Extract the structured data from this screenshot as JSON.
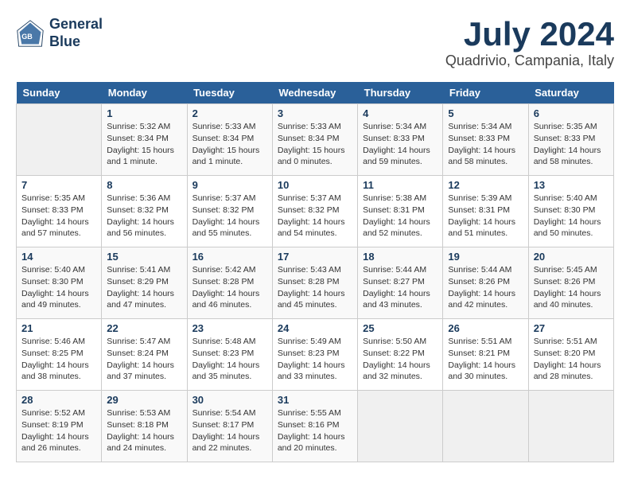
{
  "logo": {
    "line1": "General",
    "line2": "Blue"
  },
  "title": "July 2024",
  "location": "Quadrivio, Campania, Italy",
  "days_of_week": [
    "Sunday",
    "Monday",
    "Tuesday",
    "Wednesday",
    "Thursday",
    "Friday",
    "Saturday"
  ],
  "weeks": [
    [
      {
        "day": "",
        "sunrise": "",
        "sunset": "",
        "daylight": ""
      },
      {
        "day": "1",
        "sunrise": "Sunrise: 5:32 AM",
        "sunset": "Sunset: 8:34 PM",
        "daylight": "Daylight: 15 hours and 1 minute."
      },
      {
        "day": "2",
        "sunrise": "Sunrise: 5:33 AM",
        "sunset": "Sunset: 8:34 PM",
        "daylight": "Daylight: 15 hours and 1 minute."
      },
      {
        "day": "3",
        "sunrise": "Sunrise: 5:33 AM",
        "sunset": "Sunset: 8:34 PM",
        "daylight": "Daylight: 15 hours and 0 minutes."
      },
      {
        "day": "4",
        "sunrise": "Sunrise: 5:34 AM",
        "sunset": "Sunset: 8:33 PM",
        "daylight": "Daylight: 14 hours and 59 minutes."
      },
      {
        "day": "5",
        "sunrise": "Sunrise: 5:34 AM",
        "sunset": "Sunset: 8:33 PM",
        "daylight": "Daylight: 14 hours and 58 minutes."
      },
      {
        "day": "6",
        "sunrise": "Sunrise: 5:35 AM",
        "sunset": "Sunset: 8:33 PM",
        "daylight": "Daylight: 14 hours and 58 minutes."
      }
    ],
    [
      {
        "day": "7",
        "sunrise": "Sunrise: 5:35 AM",
        "sunset": "Sunset: 8:33 PM",
        "daylight": "Daylight: 14 hours and 57 minutes."
      },
      {
        "day": "8",
        "sunrise": "Sunrise: 5:36 AM",
        "sunset": "Sunset: 8:32 PM",
        "daylight": "Daylight: 14 hours and 56 minutes."
      },
      {
        "day": "9",
        "sunrise": "Sunrise: 5:37 AM",
        "sunset": "Sunset: 8:32 PM",
        "daylight": "Daylight: 14 hours and 55 minutes."
      },
      {
        "day": "10",
        "sunrise": "Sunrise: 5:37 AM",
        "sunset": "Sunset: 8:32 PM",
        "daylight": "Daylight: 14 hours and 54 minutes."
      },
      {
        "day": "11",
        "sunrise": "Sunrise: 5:38 AM",
        "sunset": "Sunset: 8:31 PM",
        "daylight": "Daylight: 14 hours and 52 minutes."
      },
      {
        "day": "12",
        "sunrise": "Sunrise: 5:39 AM",
        "sunset": "Sunset: 8:31 PM",
        "daylight": "Daylight: 14 hours and 51 minutes."
      },
      {
        "day": "13",
        "sunrise": "Sunrise: 5:40 AM",
        "sunset": "Sunset: 8:30 PM",
        "daylight": "Daylight: 14 hours and 50 minutes."
      }
    ],
    [
      {
        "day": "14",
        "sunrise": "Sunrise: 5:40 AM",
        "sunset": "Sunset: 8:30 PM",
        "daylight": "Daylight: 14 hours and 49 minutes."
      },
      {
        "day": "15",
        "sunrise": "Sunrise: 5:41 AM",
        "sunset": "Sunset: 8:29 PM",
        "daylight": "Daylight: 14 hours and 47 minutes."
      },
      {
        "day": "16",
        "sunrise": "Sunrise: 5:42 AM",
        "sunset": "Sunset: 8:28 PM",
        "daylight": "Daylight: 14 hours and 46 minutes."
      },
      {
        "day": "17",
        "sunrise": "Sunrise: 5:43 AM",
        "sunset": "Sunset: 8:28 PM",
        "daylight": "Daylight: 14 hours and 45 minutes."
      },
      {
        "day": "18",
        "sunrise": "Sunrise: 5:44 AM",
        "sunset": "Sunset: 8:27 PM",
        "daylight": "Daylight: 14 hours and 43 minutes."
      },
      {
        "day": "19",
        "sunrise": "Sunrise: 5:44 AM",
        "sunset": "Sunset: 8:26 PM",
        "daylight": "Daylight: 14 hours and 42 minutes."
      },
      {
        "day": "20",
        "sunrise": "Sunrise: 5:45 AM",
        "sunset": "Sunset: 8:26 PM",
        "daylight": "Daylight: 14 hours and 40 minutes."
      }
    ],
    [
      {
        "day": "21",
        "sunrise": "Sunrise: 5:46 AM",
        "sunset": "Sunset: 8:25 PM",
        "daylight": "Daylight: 14 hours and 38 minutes."
      },
      {
        "day": "22",
        "sunrise": "Sunrise: 5:47 AM",
        "sunset": "Sunset: 8:24 PM",
        "daylight": "Daylight: 14 hours and 37 minutes."
      },
      {
        "day": "23",
        "sunrise": "Sunrise: 5:48 AM",
        "sunset": "Sunset: 8:23 PM",
        "daylight": "Daylight: 14 hours and 35 minutes."
      },
      {
        "day": "24",
        "sunrise": "Sunrise: 5:49 AM",
        "sunset": "Sunset: 8:23 PM",
        "daylight": "Daylight: 14 hours and 33 minutes."
      },
      {
        "day": "25",
        "sunrise": "Sunrise: 5:50 AM",
        "sunset": "Sunset: 8:22 PM",
        "daylight": "Daylight: 14 hours and 32 minutes."
      },
      {
        "day": "26",
        "sunrise": "Sunrise: 5:51 AM",
        "sunset": "Sunset: 8:21 PM",
        "daylight": "Daylight: 14 hours and 30 minutes."
      },
      {
        "day": "27",
        "sunrise": "Sunrise: 5:51 AM",
        "sunset": "Sunset: 8:20 PM",
        "daylight": "Daylight: 14 hours and 28 minutes."
      }
    ],
    [
      {
        "day": "28",
        "sunrise": "Sunrise: 5:52 AM",
        "sunset": "Sunset: 8:19 PM",
        "daylight": "Daylight: 14 hours and 26 minutes."
      },
      {
        "day": "29",
        "sunrise": "Sunrise: 5:53 AM",
        "sunset": "Sunset: 8:18 PM",
        "daylight": "Daylight: 14 hours and 24 minutes."
      },
      {
        "day": "30",
        "sunrise": "Sunrise: 5:54 AM",
        "sunset": "Sunset: 8:17 PM",
        "daylight": "Daylight: 14 hours and 22 minutes."
      },
      {
        "day": "31",
        "sunrise": "Sunrise: 5:55 AM",
        "sunset": "Sunset: 8:16 PM",
        "daylight": "Daylight: 14 hours and 20 minutes."
      },
      {
        "day": "",
        "sunrise": "",
        "sunset": "",
        "daylight": ""
      },
      {
        "day": "",
        "sunrise": "",
        "sunset": "",
        "daylight": ""
      },
      {
        "day": "",
        "sunrise": "",
        "sunset": "",
        "daylight": ""
      }
    ]
  ]
}
